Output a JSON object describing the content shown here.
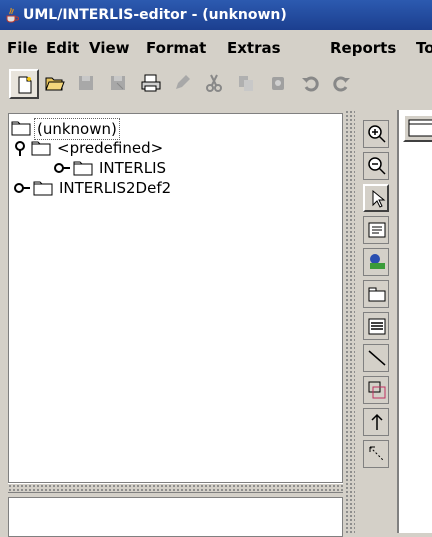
{
  "window": {
    "title": "UML/INTERLIS-editor - (unknown)"
  },
  "menu": [
    "File",
    "Edit",
    "View",
    "Format",
    "Extras",
    "Reports",
    "To"
  ],
  "toolbar": {
    "buttons": [
      "new-file-icon",
      "open-folder-icon",
      "save-icon",
      "save-as-icon",
      "print-icon",
      "pen-icon",
      "cut-icon",
      "copy-icon",
      "delete-icon",
      "undo-icon",
      "redo-icon"
    ]
  },
  "tree": {
    "root": "(unknown)",
    "predefined": "<predefined>",
    "interlis": "INTERLIS",
    "def2": "INTERLIS2Def2"
  },
  "palette": [
    "zoom-in-icon",
    "zoom-out-icon",
    "select-arrow-icon",
    "text-icon",
    "class-icon",
    "package-icon",
    "list-icon",
    "line-icon",
    "inherit-icon",
    "arrow-up-icon",
    "dashed-line-icon"
  ],
  "colors": {
    "title_bar": "#1c3f8f",
    "menu_bg": "#d4d0c8",
    "selected_border": "#666666"
  }
}
